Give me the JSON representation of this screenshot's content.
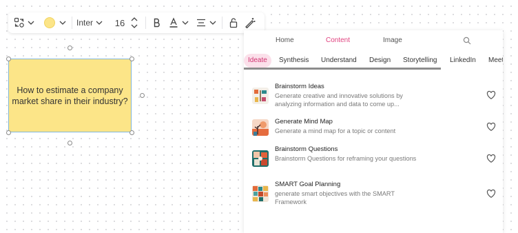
{
  "toolbar": {
    "font_name": "Inter",
    "font_size": "16",
    "fill_color": "#fce588"
  },
  "sticky_note": {
    "text": "How to estimate a company market share in their industry?",
    "color": "#fce588"
  },
  "panel": {
    "top_tabs": [
      {
        "label": "Home",
        "active": false
      },
      {
        "label": "Content",
        "active": true
      },
      {
        "label": "Image",
        "active": false
      }
    ],
    "categories": [
      {
        "label": "Ideate",
        "active": true
      },
      {
        "label": "Synthesis",
        "active": false
      },
      {
        "label": "Understand",
        "active": false
      },
      {
        "label": "Design",
        "active": false
      },
      {
        "label": "Storytelling",
        "active": false
      },
      {
        "label": "LinkedIn",
        "active": false
      },
      {
        "label": "Meet",
        "active": false
      }
    ],
    "items": [
      {
        "title": "Brainstorm Ideas",
        "description": "Generate creative and innovative solutions by analyzing information and data to come up..."
      },
      {
        "title": "Generate Mind Map",
        "description": "Generate a mind map for a topic or content"
      },
      {
        "title": "Brainstorm Questions",
        "description": "Brainstorm Questions for reframing your questions"
      },
      {
        "title": "SMART Goal Planning",
        "description": "generate smart objectives with the SMART Framework"
      }
    ]
  },
  "colors": {
    "accent": "#e0407e",
    "active_category_bg": "#fbe0ea"
  }
}
